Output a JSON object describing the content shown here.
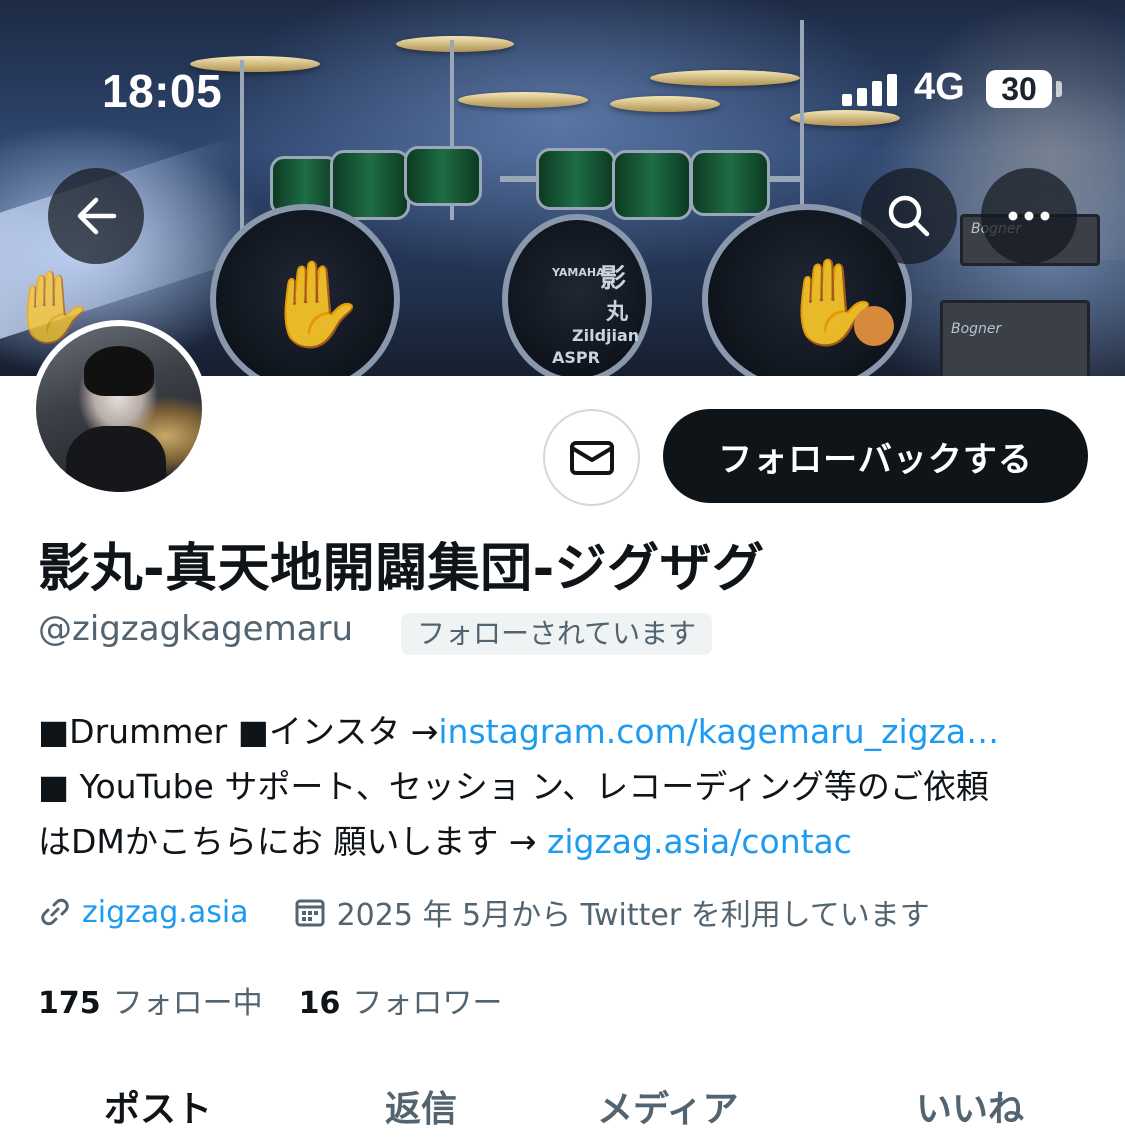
{
  "status_bar": {
    "time": "18:05",
    "network": "4G",
    "battery": "30"
  },
  "header": {
    "back_icon": "arrow-left-icon",
    "search_icon": "search-icon",
    "more_icon": "more-horizontal-icon",
    "banner_texts": {
      "bass_drum_name_1": "影",
      "bass_drum_name_2": "丸",
      "brand_cymbal": "Zildjian",
      "brand_drums": "YAMAHA",
      "sponsor": "ASPR",
      "amp_brand_1": "Bogner",
      "amp_brand_2": "Bogner"
    }
  },
  "profile": {
    "display_name": "影丸-真天地開闢集団-ジグザグ",
    "handle": "@zigzagkagemaru",
    "follows_you_badge": "フォローされています",
    "message_icon": "envelope-icon",
    "follow_button": "フォローバックする",
    "bio": {
      "line1_text": "■Drummer ■インスタ →",
      "line1_link": "instagram.com/kagemaru_zigza…",
      "line2_text": "■ YouTube サポート、セッショ ン、レコーディング等のご依頼",
      "line3_text": "はDMかこちらにお 願いします → ",
      "line3_link": "zigzag.asia/contac"
    },
    "website": "zigzag.asia",
    "joined": "2025 年 5月から Twitter を利用しています",
    "following_count": "175",
    "following_label": "フォロー中",
    "followers_count": "16",
    "followers_label": "フォロワー"
  },
  "tabs": [
    {
      "label": "ポスト",
      "active": true
    },
    {
      "label": "返信",
      "active": false
    },
    {
      "label": "メディア",
      "active": false
    },
    {
      "label": "いいね",
      "active": false
    }
  ],
  "colors": {
    "link": "#1d9bf0",
    "secondary_text": "#536471",
    "primary_text": "#0f1419",
    "button_dark": "#0f1419"
  }
}
